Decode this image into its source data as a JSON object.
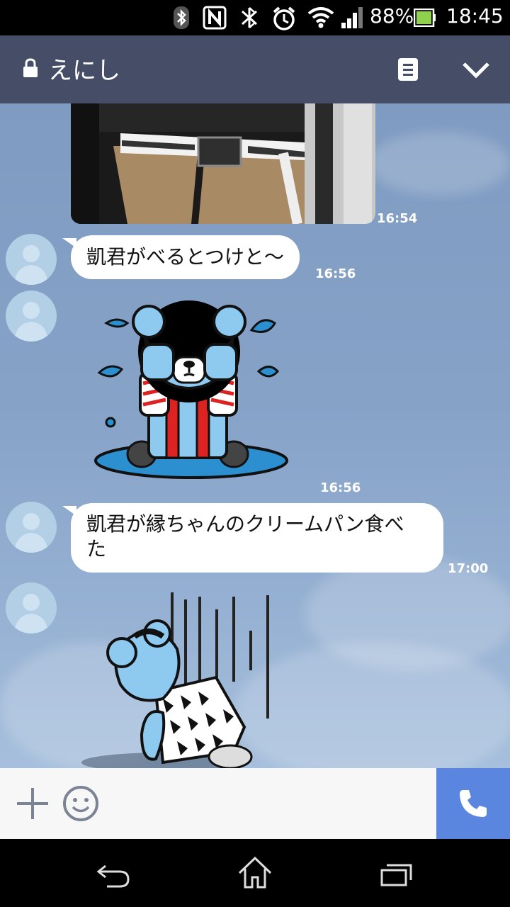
{
  "status_bar": {
    "battery_percent": "88%",
    "time": "18:45",
    "icons": [
      "bluetooth-icon",
      "nfc-icon",
      "mute-icon",
      "alarm-icon",
      "wifi-icon",
      "signal-icon",
      "battery-icon"
    ]
  },
  "header": {
    "title": "えにし",
    "icons": [
      "lock-icon",
      "note-icon",
      "chevron-down-icon"
    ]
  },
  "messages": [
    {
      "type": "image",
      "time": "16:54"
    },
    {
      "type": "text",
      "text": "凱君がべるとつけと〜",
      "time": "16:56"
    },
    {
      "type": "sticker",
      "time": "16:56"
    },
    {
      "type": "text",
      "text_line1": "凱君が縁ちゃんのクリームパン食べ",
      "text_line2": "た",
      "time": "17:00"
    },
    {
      "type": "sticker"
    }
  ],
  "input_bar": {
    "icons": [
      "plus-icon",
      "emoji-icon",
      "phone-icon"
    ]
  },
  "nav_bar": {
    "icons": [
      "back-icon",
      "home-icon",
      "recent-apps-icon"
    ]
  },
  "colors": {
    "header_bg": "#454e66",
    "call_button": "#5b86e0",
    "chat_bg": "#86a2c7"
  }
}
